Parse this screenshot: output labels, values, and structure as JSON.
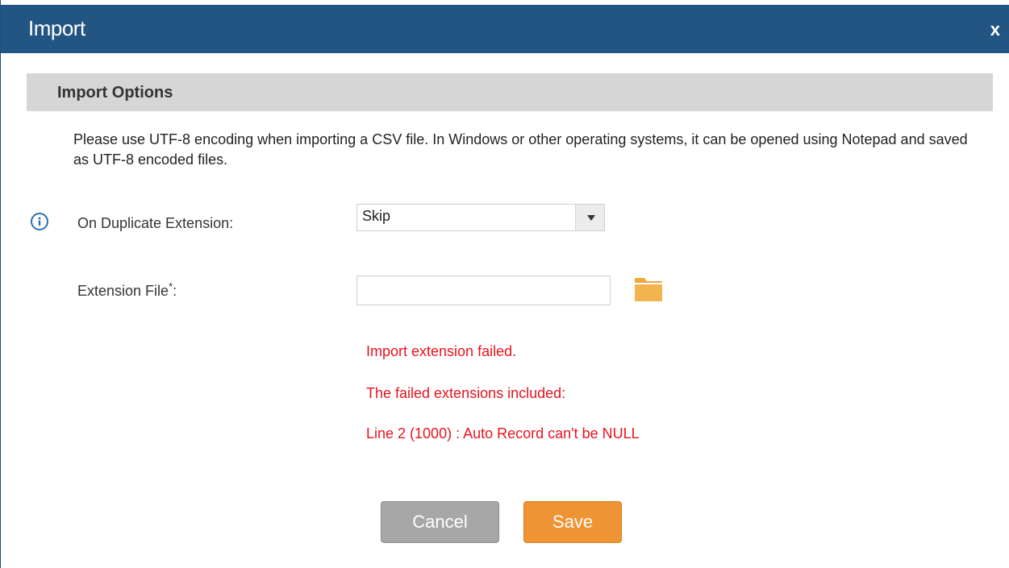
{
  "dialog": {
    "title": "Import",
    "close_label": "x"
  },
  "section": {
    "title": "Import Options"
  },
  "note": "Please use UTF-8 encoding when importing a CSV file. In Windows or other operating systems, it can be opened using Notepad and saved as UTF-8 encoded files.",
  "form": {
    "duplicate_label": "On Duplicate Extension:",
    "duplicate_value": "Skip",
    "file_label": "Extension File",
    "file_required_mark": "*",
    "file_label_suffix": ":",
    "file_value": ""
  },
  "errors": [
    "Import extension failed.",
    "The failed extensions included:",
    "Line 2 (1000) : Auto Record can't be NULL"
  ],
  "buttons": {
    "cancel": "Cancel",
    "save": "Save"
  },
  "icons": {
    "info": "info-icon",
    "dropdown": "chevron-down-icon",
    "folder": "folder-icon"
  },
  "colors": {
    "titlebar": "#235583",
    "error": "#e8131d",
    "save": "#ef9434",
    "cancel": "#a7a7a7"
  }
}
